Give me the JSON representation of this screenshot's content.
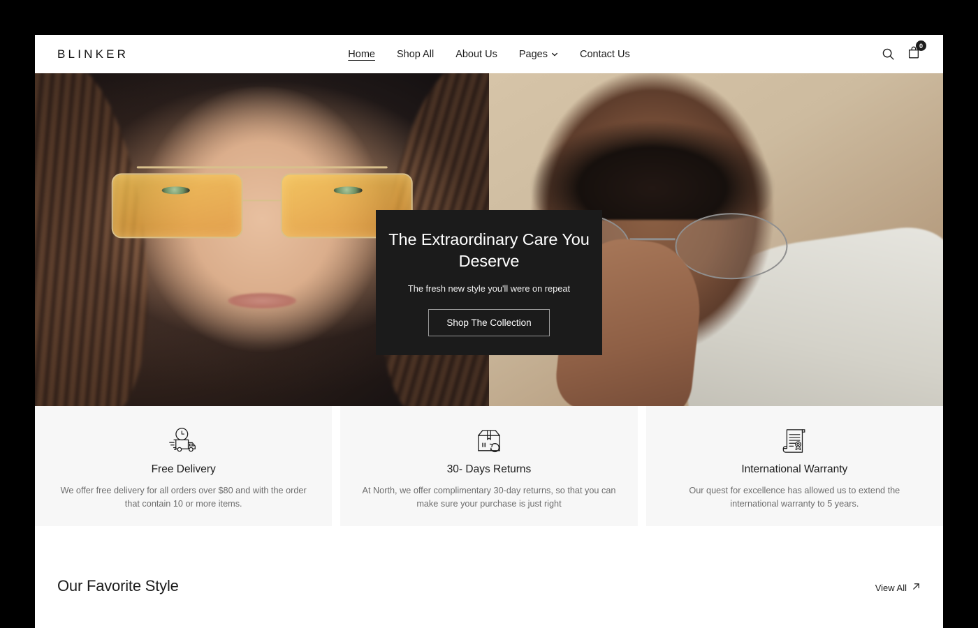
{
  "brand": {
    "logo": "BLINKER"
  },
  "nav": {
    "items": [
      {
        "label": "Home",
        "active": true
      },
      {
        "label": "Shop All",
        "active": false
      },
      {
        "label": "About Us",
        "active": false
      },
      {
        "label": "Pages",
        "active": false,
        "icon": "chevron-down-icon"
      },
      {
        "label": "Contact Us",
        "active": false
      }
    ]
  },
  "actions": {
    "search_icon": "search-icon",
    "cart_icon": "shopping-bag-icon",
    "cart_count": "0"
  },
  "hero": {
    "title": "The Extraordinary Care You Deserve",
    "subtitle": "The fresh new style you'll were on repeat",
    "cta": "Shop The Collection",
    "left_image_alt": "woman-wearing-yellow-tinted-aviator-glasses",
    "right_image_alt": "man-wearing-round-metal-glasses"
  },
  "features": [
    {
      "icon": "delivery-truck-clock-icon",
      "title": "Free Delivery",
      "desc": "We offer free delivery for all orders over $80 and with the order that contain 10 or more items."
    },
    {
      "icon": "return-box-icon",
      "title": "30- Days Returns",
      "desc": "At North, we offer complimentary 30-day returns, so that you can make sure your purchase is just right"
    },
    {
      "icon": "warranty-certificate-icon",
      "title": "International Warranty",
      "desc": "Our quest for excellence has allowed us to extend the international warranty to 5 years."
    }
  ],
  "favorites": {
    "title": "Our Favorite Style",
    "view_all": "View All",
    "view_all_icon": "arrow-up-right-icon"
  },
  "colors": {
    "page_background": "#000000",
    "surface": "#ffffff",
    "card_dark": "#1b1b1b",
    "feature_card": "#f7f7f7",
    "text_primary": "#1c1c1c",
    "text_muted": "#6d6d6d"
  }
}
